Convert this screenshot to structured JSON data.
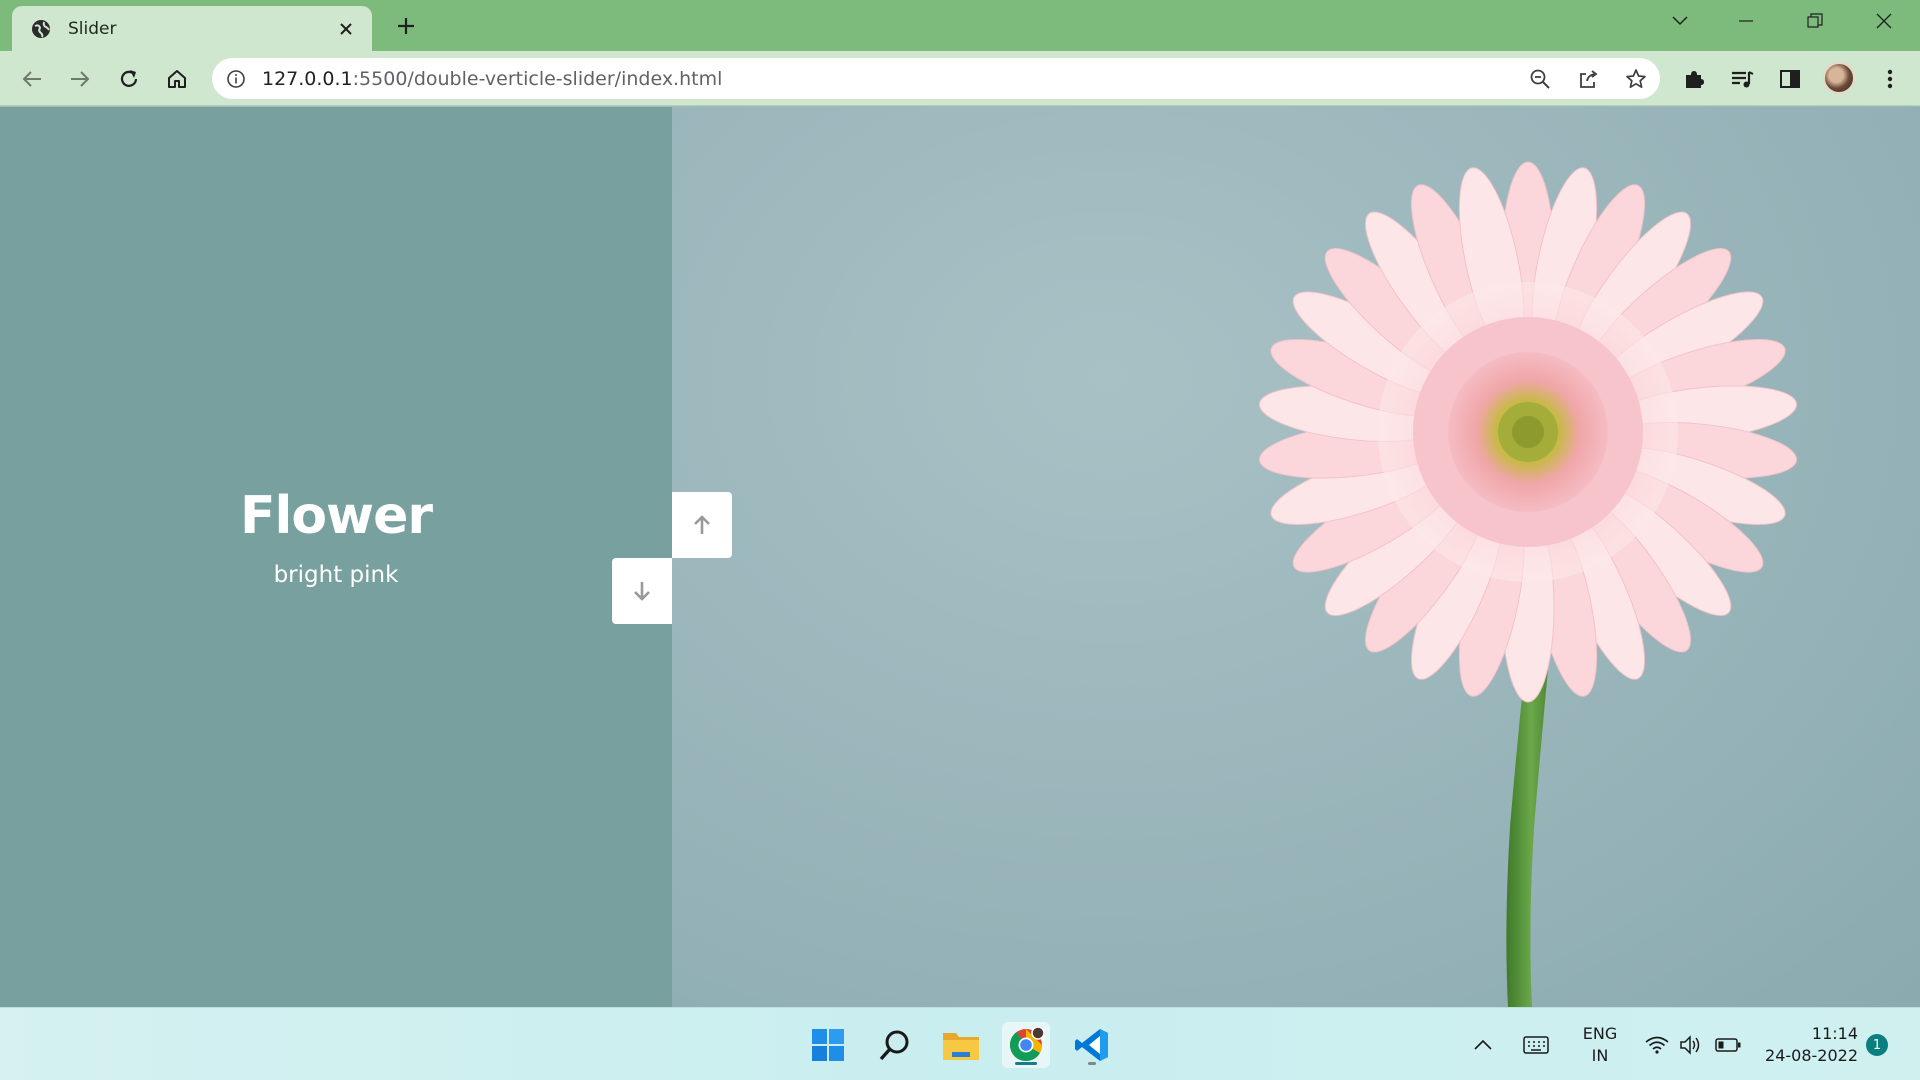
{
  "browser": {
    "tab": {
      "title": "Slider",
      "favicon": "globe-icon"
    },
    "address": {
      "host": "127.0.0.1",
      "path": ":5500/double-verticle-slider/index.html"
    }
  },
  "slide": {
    "title": "Flower",
    "subtitle": "bright pink"
  },
  "controls": {
    "up": "arrow-up-icon",
    "down": "arrow-down-icon"
  },
  "taskbar": {
    "apps": [
      "windows-start",
      "search",
      "file-explorer",
      "chrome",
      "vscode"
    ],
    "lang_line1": "ENG",
    "lang_line2": "IN",
    "time": "11:14",
    "date": "24-08-2022",
    "notifications": "1"
  },
  "colors": {
    "left_panel": "#77a09e",
    "right_bg": "#9fb8bd",
    "tab_strip": "#7dbb7d",
    "toolbar": "#cfe6cf"
  }
}
